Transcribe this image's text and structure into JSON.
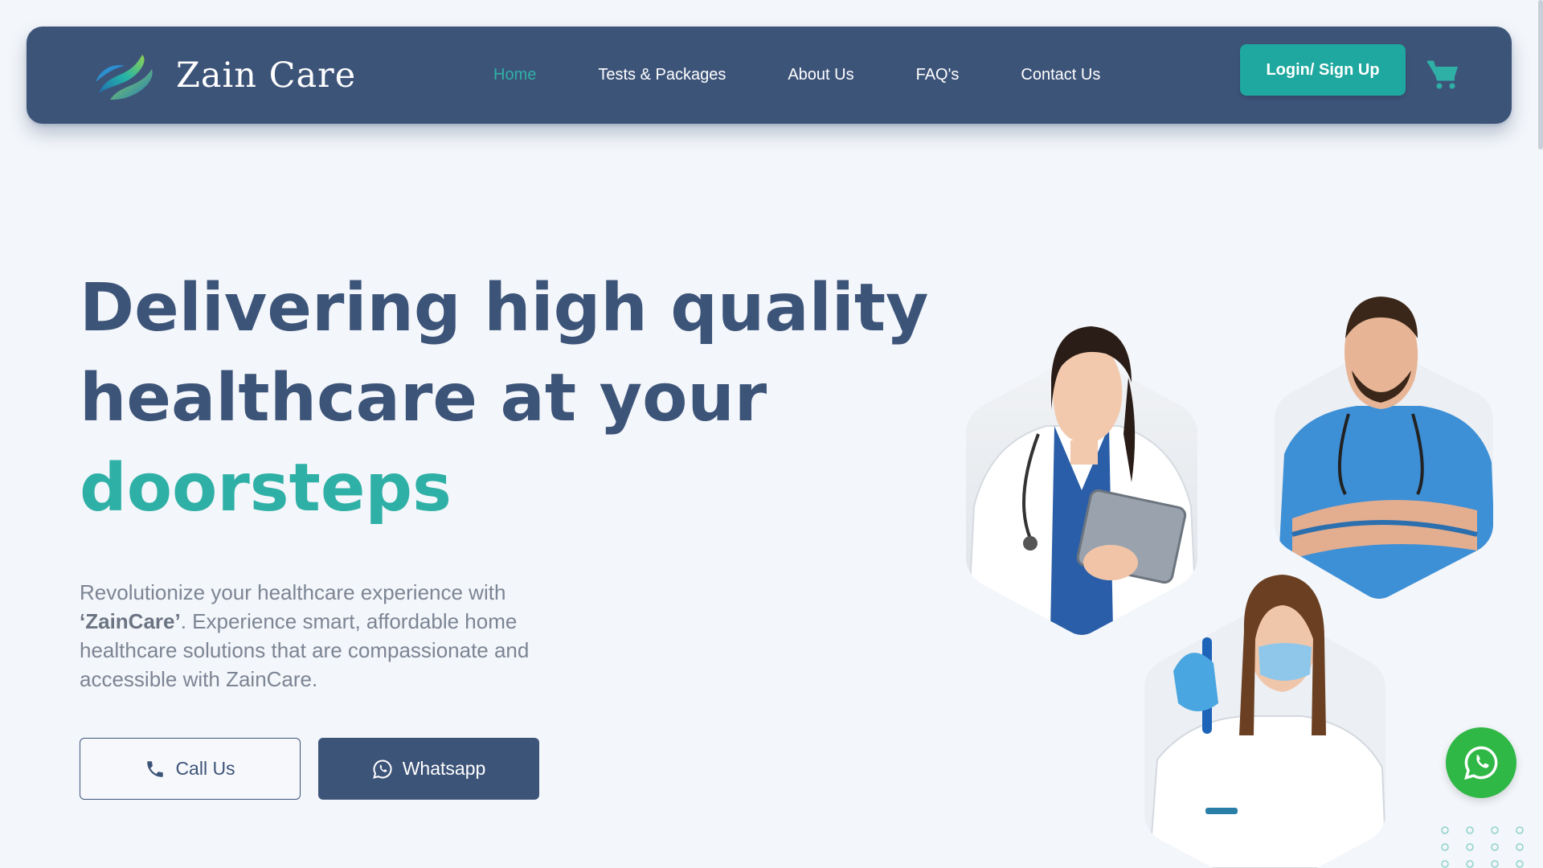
{
  "brand": {
    "name": "Zain Care"
  },
  "nav": {
    "items": [
      {
        "label": "Home",
        "active": true
      },
      {
        "label": "Tests & Packages",
        "active": false
      },
      {
        "label": "About Us",
        "active": false
      },
      {
        "label": "FAQ's",
        "active": false
      },
      {
        "label": "Contact Us",
        "active": false
      }
    ],
    "login_label": "Login/ Sign Up",
    "cart_icon": "cart-icon"
  },
  "hero": {
    "title_line1": "Delivering high quality",
    "title_line2": "healthcare at your",
    "title_accent": "doorsteps",
    "desc_part1": "Revolutionize your healthcare experience with ",
    "desc_brand": "‘ZainCare’",
    "desc_part2": ". Experience smart, affordable home healthcare solutions that are compassionate and accessible with ZainCare.",
    "call_label": "Call Us",
    "whatsapp_label": "Whatsapp"
  },
  "images": {
    "doctor_female": "doctor-with-tablet-image",
    "doctor_male": "male-nurse-image",
    "lab_tech": "lab-technician-image"
  },
  "colors": {
    "primary": "#3d5479",
    "accent": "#2fb0a6",
    "login_button": "#1fa89f",
    "whatsapp_green": "#2fb845",
    "background": "#f3f6fa"
  }
}
